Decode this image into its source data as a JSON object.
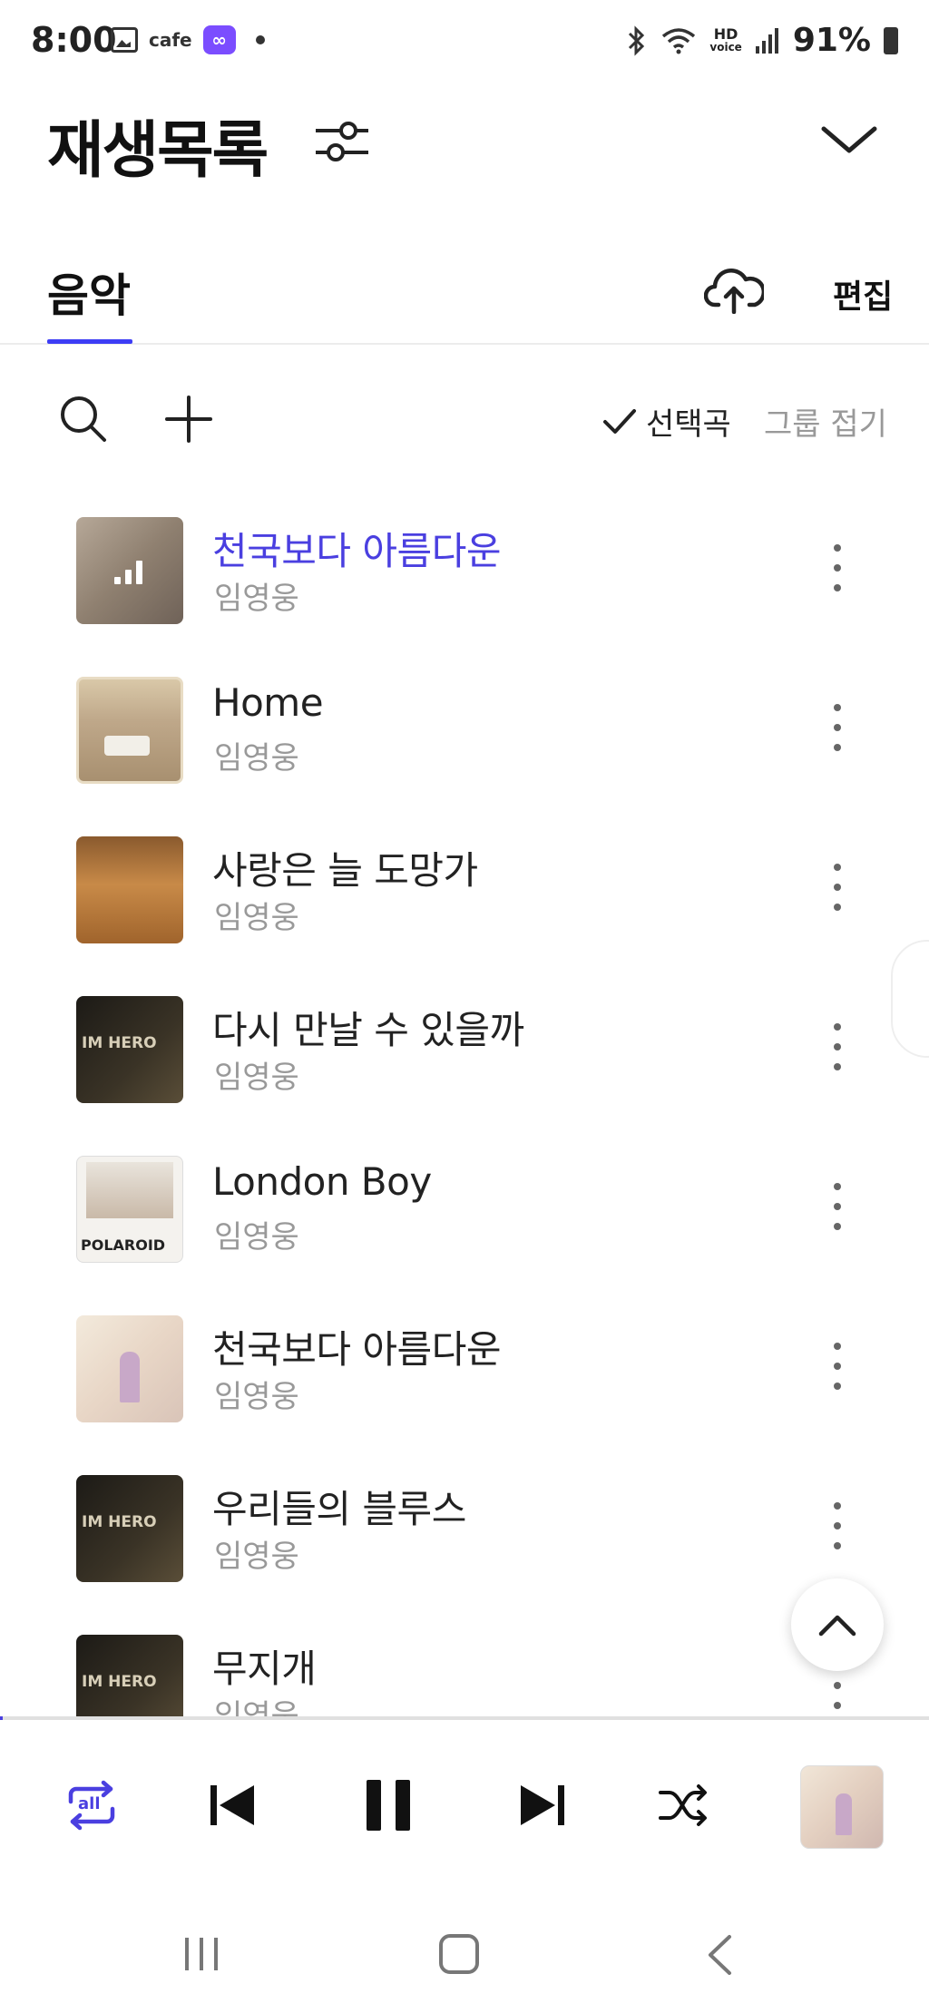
{
  "status_bar": {
    "time": "8:00",
    "cafe_label": "cafe",
    "cafe_badge": "∞",
    "hd_line1": "HD",
    "hd_line2": "voice",
    "battery": "91%"
  },
  "header": {
    "title": "재생목록",
    "filter_icon": "sliders-icon",
    "collapse_icon": "chevron-down-icon"
  },
  "tabs": {
    "music": "음악",
    "edit": "편집",
    "upload_icon": "cloud-upload-icon"
  },
  "toolbar": {
    "select_songs": "선택곡",
    "fold_group": "그룹 접기"
  },
  "tracks": [
    {
      "title": "천국보다 아름다운",
      "artist": "임영웅",
      "active": true
    },
    {
      "title": "Home",
      "artist": "임영웅",
      "active": false
    },
    {
      "title": "사랑은 늘 도망가",
      "artist": "임영웅",
      "active": false
    },
    {
      "title": "다시 만날 수 있을까",
      "artist": "임영웅",
      "active": false
    },
    {
      "title": "London Boy",
      "artist": "임영웅",
      "active": false
    },
    {
      "title": "천국보다 아름다운",
      "artist": "임영웅",
      "active": false
    },
    {
      "title": "우리들의 블루스",
      "artist": "임영웅",
      "active": false
    },
    {
      "title": "무지개",
      "artist": "임영웅",
      "active": false
    }
  ],
  "album_text": {
    "im_hero": "IM HERO",
    "polaroid": "POLAROID"
  },
  "player": {
    "repeat_label": "all",
    "progress_fraction": 0.003
  },
  "colors": {
    "accent": "#4a3fe0",
    "muted_text": "#999999"
  }
}
